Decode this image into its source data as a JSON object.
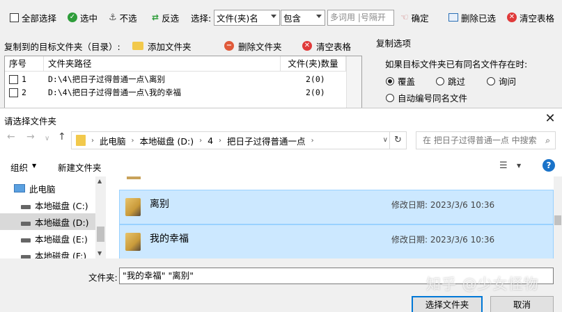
{
  "app": {
    "toolbar": {
      "select_all": "全部选择",
      "select": "选中",
      "unselect": "不选",
      "invert": "反选",
      "choose_label": "选择:",
      "field_dropdown": "文件(夹)名",
      "match_dropdown": "包含",
      "keywords_placeholder": "多词用 |号隔开",
      "confirm": "确定",
      "delete_selected": "删除已选",
      "clear_table": "清空表格"
    },
    "target_section": {
      "label": "复制到的目标文件夹（目录）:",
      "add_folder": "添加文件夹",
      "delete_folder": "删除文件夹",
      "clear_table": "清空表格"
    },
    "table": {
      "columns": [
        "序号",
        "文件夹路径",
        "文件(夹)数量"
      ],
      "rows": [
        {
          "index": "1",
          "path": "D:\\4\\把日子过得普通一点\\离别",
          "count": "2(0)"
        },
        {
          "index": "2",
          "path": "D:\\4\\把日子过得普通一点\\我的幸福",
          "count": "2(0)"
        }
      ]
    },
    "copy_options": {
      "title": "复制选项",
      "question": "如果目标文件夹已有同名文件存在时:",
      "overwrite": "覆盖",
      "skip": "跳过",
      "ask": "询问",
      "auto_rename": "自动编号同名文件",
      "selected": "overwrite"
    }
  },
  "dialog": {
    "title": "请选择文件夹",
    "breadcrumb": [
      "此电脑",
      "本地磁盘 (D:)",
      "4",
      "把日子过得普通一点"
    ],
    "search_placeholder": "在 把日子过得普通一点 中搜索",
    "organize": "组织",
    "new_folder": "新建文件夹",
    "sidebar": [
      {
        "label": "此电脑",
        "icon": "computer-icon"
      },
      {
        "label": "本地磁盘 (C:)",
        "icon": "drive-icon"
      },
      {
        "label": "本地磁盘 (D:)",
        "icon": "drive-icon",
        "selected": true
      },
      {
        "label": "本地磁盘 (E:)",
        "icon": "drive-icon"
      },
      {
        "label": "本地磁盘 (F:)",
        "icon": "drive-icon"
      }
    ],
    "files": [
      {
        "name": "离别",
        "date_label": "修改日期:",
        "date": "2023/3/6 10:36"
      },
      {
        "name": "我的幸福",
        "date_label": "修改日期:",
        "date": "2023/3/6 10:36"
      }
    ],
    "filename_label": "文件夹:",
    "filename_value": "\"我的幸福\" \"离别\"",
    "select_button": "选择文件夹",
    "cancel_button": "取消",
    "watermark": "知乎 @少女怪物"
  },
  "colors": {
    "selection_bg": "#cce8ff",
    "selection_border": "#99d1ff",
    "primary_border": "#0078d7",
    "delete_red": "#e03a3a",
    "check_green": "#2e9d3a",
    "help_blue": "#1a73c9"
  }
}
